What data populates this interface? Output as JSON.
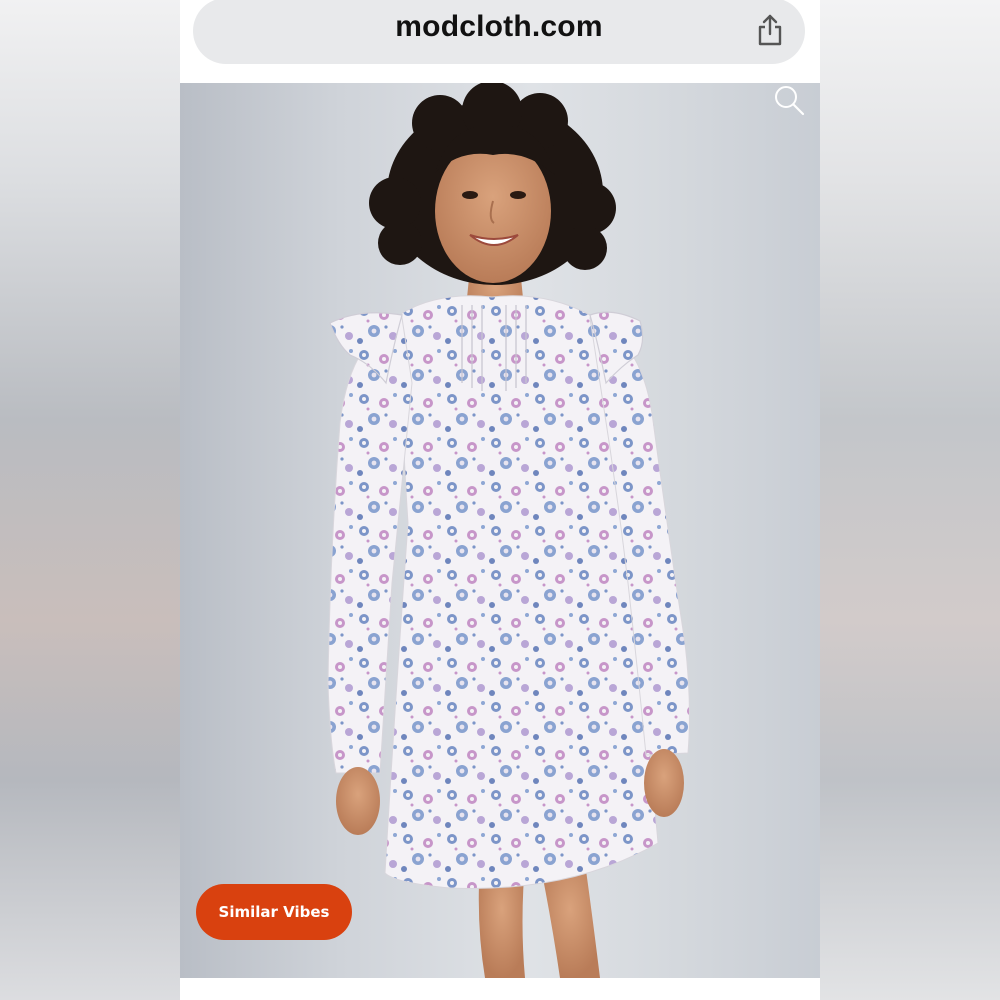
{
  "browser": {
    "url": "modcloth.com",
    "share_icon": "share-icon"
  },
  "product": {
    "image_alt": "Woman wearing a long-sleeve floral mini dress with ruffled shoulders and pintuck yoke",
    "search_icon": "search-icon",
    "similar_button_label": "Similar Vibes"
  },
  "colors": {
    "accent": "#d9410f",
    "background": "#dfe2e6",
    "url_bar": "#e8e9eb"
  }
}
